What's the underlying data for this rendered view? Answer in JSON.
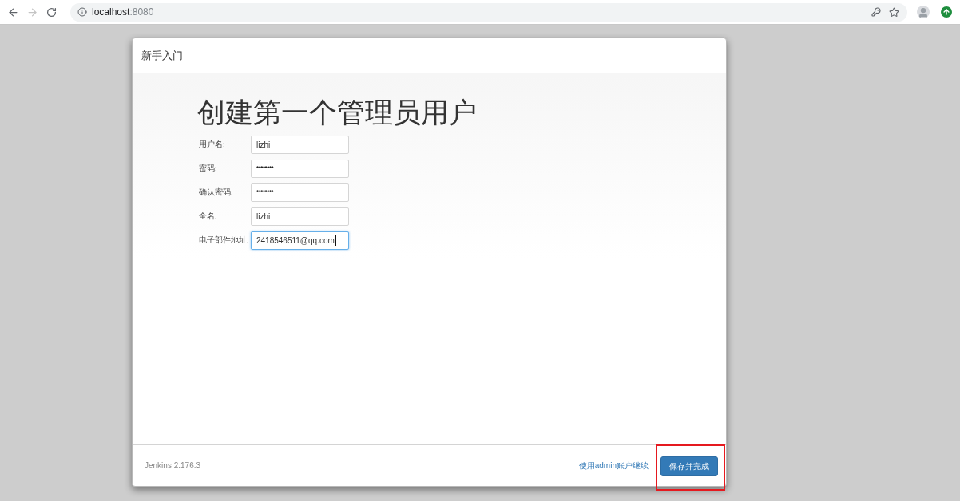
{
  "browser": {
    "nav_buttons": [
      {
        "kind": "back",
        "disabled": false
      },
      {
        "kind": "forward",
        "disabled": true
      },
      {
        "kind": "reload",
        "disabled": false
      }
    ],
    "url": {
      "host": "localhost",
      "port": ":8080"
    }
  },
  "dialog": {
    "title": "新手入门",
    "heading": "创建第一个管理员用户",
    "fields": [
      {
        "label": "用户名:",
        "value": "lizhi",
        "kind": "text",
        "focused": false
      },
      {
        "label": "密码:",
        "value": "••••••••",
        "kind": "password",
        "focused": false
      },
      {
        "label": "确认密码:",
        "value": "••••••••",
        "kind": "password",
        "focused": false
      },
      {
        "label": "全名:",
        "value": "lizhi",
        "kind": "text",
        "focused": false
      },
      {
        "label": "电子部件地址:",
        "value": "2418546511@qq.com",
        "kind": "text",
        "focused": true
      }
    ],
    "footer": {
      "version": "Jenkins 2.176.3",
      "link": "使用admin账户继续",
      "button": {
        "label": "保存并完成",
        "highlighted": true
      }
    }
  }
}
